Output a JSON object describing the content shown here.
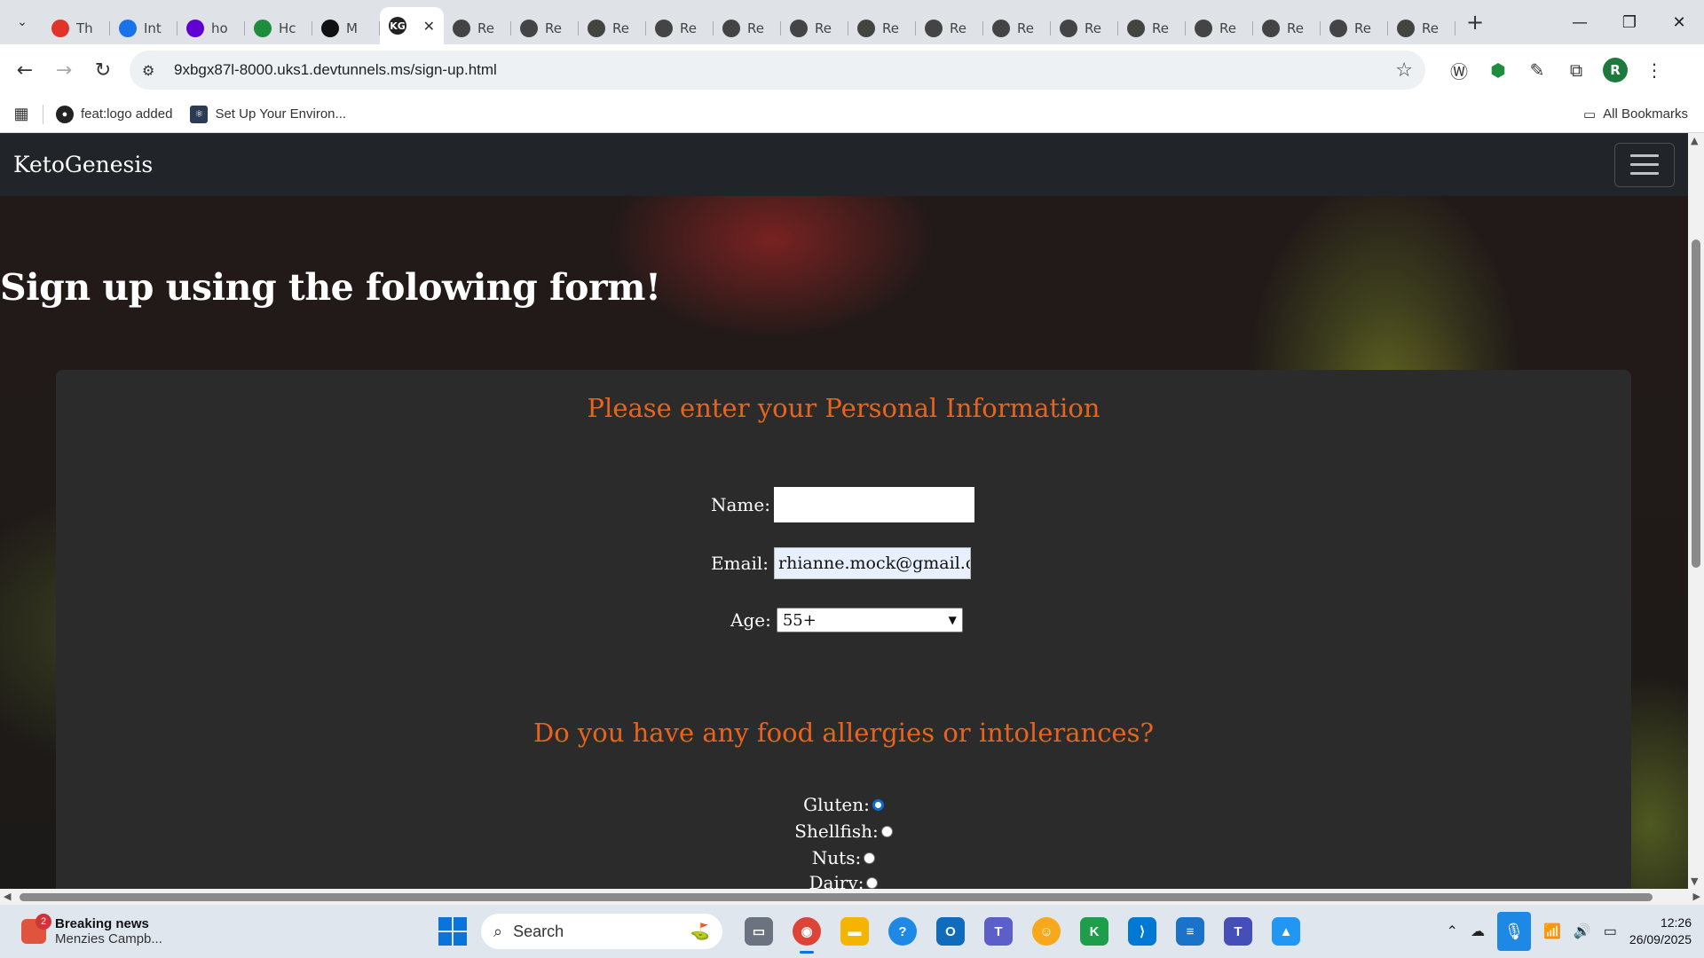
{
  "browser": {
    "tabs": [
      {
        "label": "Th",
        "icon": "opera-icon",
        "color": "#e0332a"
      },
      {
        "label": "Int",
        "icon": "chrome-icon",
        "color": "#1a73e8"
      },
      {
        "label": "ho",
        "icon": "yahoo-icon",
        "color": "#5f01d1"
      },
      {
        "label": "Hc",
        "icon": "link-icon",
        "color": "#1e8e3e"
      },
      {
        "label": "M",
        "icon": "github-icon",
        "color": "#111111"
      },
      {
        "label": "",
        "icon": "ketogenesis-icon",
        "color": "#222222",
        "active": true
      },
      {
        "label": "Re",
        "icon": "globe-icon",
        "color": "#444444"
      },
      {
        "label": "Re",
        "icon": "globe-icon",
        "color": "#444444"
      },
      {
        "label": "Re",
        "icon": "globe-icon",
        "color": "#444444"
      },
      {
        "label": "Re",
        "icon": "globe-icon",
        "color": "#444444"
      },
      {
        "label": "Re",
        "icon": "globe-icon",
        "color": "#444444"
      },
      {
        "label": "Re",
        "icon": "globe-icon",
        "color": "#444444"
      },
      {
        "label": "Re",
        "icon": "globe-icon",
        "color": "#444444"
      },
      {
        "label": "Re",
        "icon": "globe-icon",
        "color": "#444444"
      },
      {
        "label": "Re",
        "icon": "globe-icon",
        "color": "#444444"
      },
      {
        "label": "Re",
        "icon": "globe-icon",
        "color": "#444444"
      },
      {
        "label": "Re",
        "icon": "globe-icon",
        "color": "#444444"
      },
      {
        "label": "Re",
        "icon": "globe-icon",
        "color": "#444444"
      },
      {
        "label": "Re",
        "icon": "globe-icon",
        "color": "#444444"
      },
      {
        "label": "Re",
        "icon": "globe-icon",
        "color": "#444444"
      },
      {
        "label": "Re",
        "icon": "globe-icon",
        "color": "#444444"
      }
    ],
    "active_tab_favicon": "KG",
    "url": "9xbgx87l-8000.uks1.devtunnels.ms/sign-up.html",
    "profile_initial": "R",
    "bookmarks": [
      {
        "label": "feat:logo added",
        "icon": "github-icon"
      },
      {
        "label": "Set Up Your Environ...",
        "icon": "react-icon"
      }
    ],
    "all_bookmarks_label": "All Bookmarks"
  },
  "site": {
    "brand": "KetoGenesis",
    "heading": "Sign up using the folowing form!",
    "personal_title": "Please enter your Personal Information",
    "name_label": "Name:",
    "name_value": "",
    "email_label": "Email:",
    "email_value": "rhianne.mock@gmail.co",
    "age_label": "Age:",
    "age_value": "55+",
    "allergy_title": "Do you have any food allergies or intolerances?",
    "allergies": [
      {
        "label": "Gluten:",
        "checked": true
      },
      {
        "label": "Shellfish:",
        "checked": false
      },
      {
        "label": "Nuts:",
        "checked": false
      },
      {
        "label": "Dairy:",
        "checked": false
      }
    ],
    "colors": {
      "accent": "#e8641d",
      "nav_bg": "#212529",
      "card_bg": "#2b2b2b"
    }
  },
  "taskbar": {
    "news_badge": "2",
    "news_title": "Breaking news",
    "news_subtitle": "Menzies Campb...",
    "search_placeholder": "Search",
    "apps": [
      "task-view-icon",
      "chrome-icon",
      "file-explorer-icon",
      "help-icon",
      "outlook-icon",
      "teams-icon",
      "discord-icon",
      "kotlin-icon",
      "vscode-icon",
      "notepad-icon",
      "teams-work-icon",
      "photos-icon"
    ],
    "time": "12:26",
    "date": "26/09/2025"
  }
}
